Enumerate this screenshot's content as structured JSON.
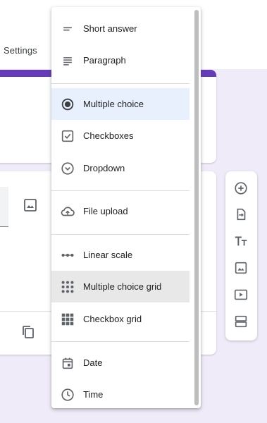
{
  "tabs": {
    "settings": "Settings"
  },
  "menu": {
    "items": [
      {
        "label": "Short answer",
        "icon": "short-text-icon"
      },
      {
        "label": "Paragraph",
        "icon": "paragraph-icon"
      },
      {
        "label": "Multiple choice",
        "icon": "radio-checked-icon",
        "selected": true
      },
      {
        "label": "Checkboxes",
        "icon": "checkbox-icon"
      },
      {
        "label": "Dropdown",
        "icon": "dropdown-circle-icon"
      },
      {
        "label": "File upload",
        "icon": "cloud-upload-icon"
      },
      {
        "label": "Linear scale",
        "icon": "linear-scale-icon"
      },
      {
        "label": "Multiple choice grid",
        "icon": "dot-grid-icon",
        "hovered": true
      },
      {
        "label": "Checkbox grid",
        "icon": "checkbox-grid-icon"
      },
      {
        "label": "Date",
        "icon": "calendar-icon"
      },
      {
        "label": "Time",
        "icon": "clock-icon"
      }
    ]
  },
  "toolbar": {
    "tools": [
      "add-question-icon",
      "import-questions-icon",
      "add-title-icon",
      "add-image-icon",
      "add-video-icon",
      "add-section-icon"
    ]
  },
  "colors": {
    "accent": "#673ab7",
    "background": "#f0ebf8",
    "selected": "#e8f0fe",
    "icon": "#5f6368"
  }
}
